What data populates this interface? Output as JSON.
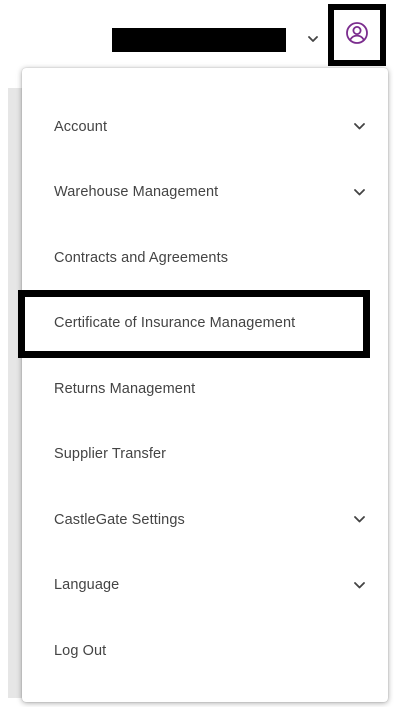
{
  "header": {
    "account_name_redacted": true,
    "user_icon": "user-circle-icon",
    "user_icon_color": "#7b2d8e"
  },
  "menu": {
    "items": [
      {
        "label": "Account",
        "has_submenu": true
      },
      {
        "label": "Warehouse Management",
        "has_submenu": true
      },
      {
        "label": "Contracts and Agreements",
        "has_submenu": false,
        "highlighted": true
      },
      {
        "label": "Certificate of Insurance Management",
        "has_submenu": false
      },
      {
        "label": "Returns Management",
        "has_submenu": false
      },
      {
        "label": "Supplier Transfer",
        "has_submenu": false
      },
      {
        "label": "CastleGate Settings",
        "has_submenu": true
      },
      {
        "label": "Language",
        "has_submenu": true
      },
      {
        "label": "Log Out",
        "has_submenu": false
      }
    ]
  },
  "colors": {
    "text": "#444444",
    "highlight_border": "#000000",
    "accent": "#7b2d8e"
  }
}
